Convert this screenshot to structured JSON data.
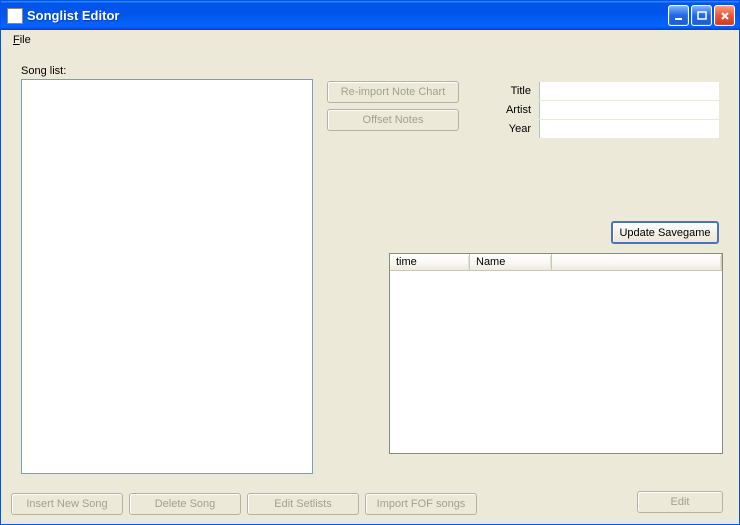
{
  "window": {
    "title": "Songlist Editor"
  },
  "menu": {
    "file": "File"
  },
  "labels": {
    "songlist": "Song list:",
    "title": "Title",
    "artist": "Artist",
    "year": "Year"
  },
  "buttons": {
    "reimport": "Re-import Note Chart",
    "offset": "Offset Notes",
    "update_savegame": "Update Savegame",
    "insert_new_song": "Insert New Song",
    "delete_song": "Delete Song",
    "edit_setlists": "Edit Setlists",
    "import_fof": "Import FOF songs",
    "edit": "Edit"
  },
  "fields": {
    "title": "",
    "artist": "",
    "year": ""
  },
  "table": {
    "columns": {
      "time": "time",
      "name": "Name"
    },
    "rows": []
  }
}
